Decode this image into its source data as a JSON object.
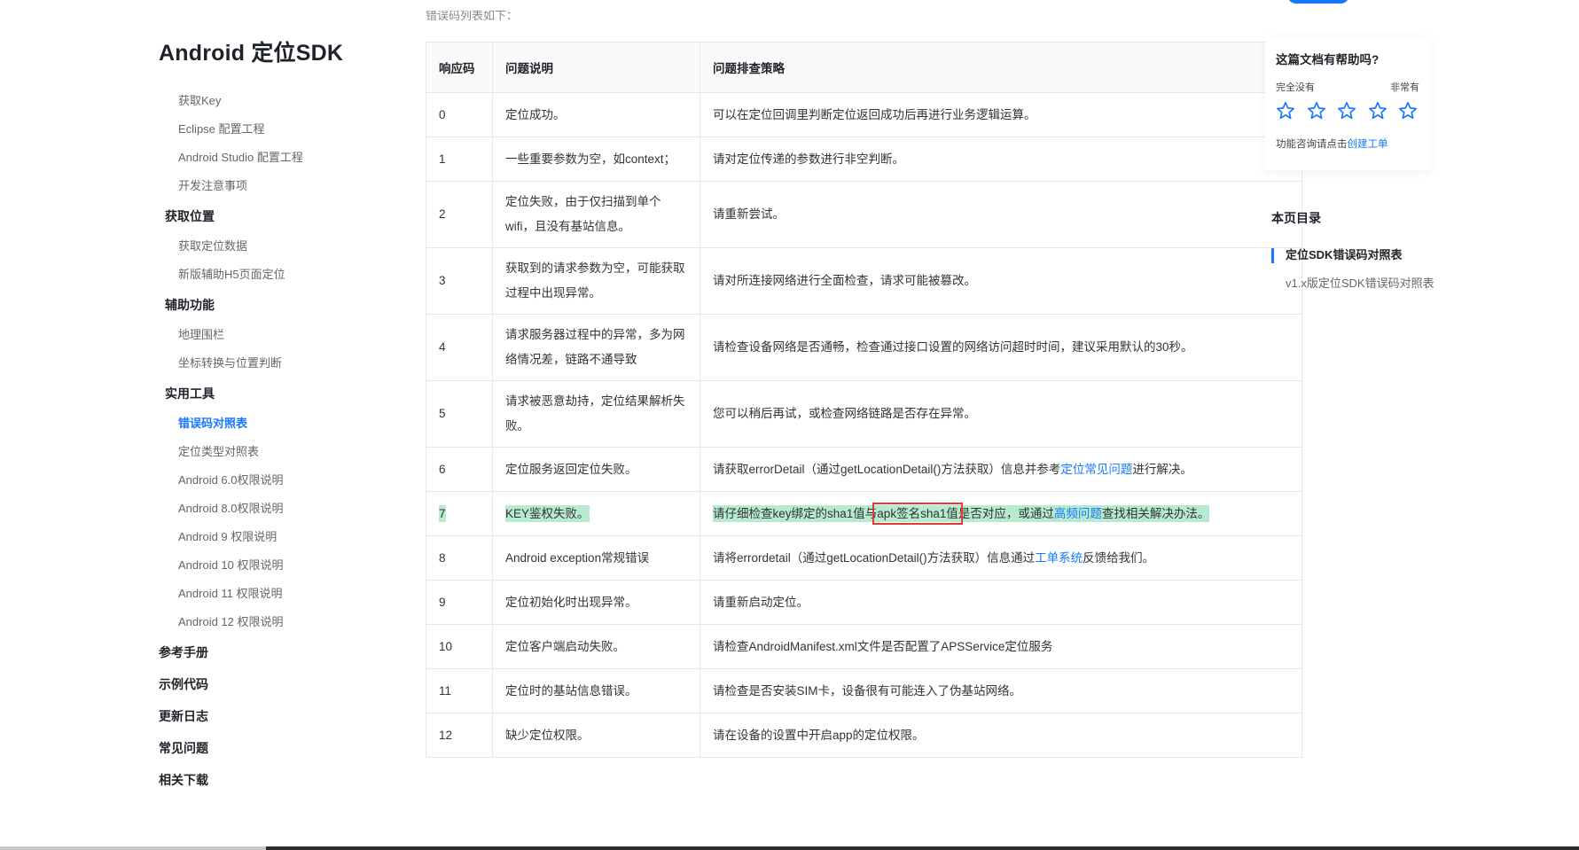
{
  "sidebar": {
    "title": "Android 定位SDK",
    "items": [
      {
        "label": "获取Key",
        "type": "item"
      },
      {
        "label": "Eclipse 配置工程",
        "type": "item"
      },
      {
        "label": "Android Studio 配置工程",
        "type": "item"
      },
      {
        "label": "开发注意事项",
        "type": "item"
      },
      {
        "label": "获取位置",
        "type": "group"
      },
      {
        "label": "获取定位数据",
        "type": "item"
      },
      {
        "label": "新版辅助H5页面定位",
        "type": "item"
      },
      {
        "label": "辅助功能",
        "type": "group"
      },
      {
        "label": "地理围栏",
        "type": "item"
      },
      {
        "label": "坐标转换与位置判断",
        "type": "item"
      },
      {
        "label": "实用工具",
        "type": "group"
      },
      {
        "label": "错误码对照表",
        "type": "item",
        "active": true
      },
      {
        "label": "定位类型对照表",
        "type": "item"
      },
      {
        "label": "Android 6.0权限说明",
        "type": "item"
      },
      {
        "label": "Android 8.0权限说明",
        "type": "item"
      },
      {
        "label": "Android 9 权限说明",
        "type": "item"
      },
      {
        "label": "Android 10 权限说明",
        "type": "item"
      },
      {
        "label": "Android 11 权限说明",
        "type": "item"
      },
      {
        "label": "Android 12 权限说明",
        "type": "item"
      },
      {
        "label": "参考手册",
        "type": "top"
      },
      {
        "label": "示例代码",
        "type": "top"
      },
      {
        "label": "更新日志",
        "type": "top"
      },
      {
        "label": "常见问题",
        "type": "top"
      },
      {
        "label": "相关下载",
        "type": "top"
      }
    ]
  },
  "intro_text": "错误码列表如下：",
  "table": {
    "headers": [
      "响应码",
      "问题说明",
      "问题排查策略"
    ],
    "rows": [
      {
        "code": "0",
        "desc": "定位成功。",
        "strategy": [
          {
            "t": "可以在定位回调里判断定位返回成功后再进行业务逻辑运算。"
          }
        ]
      },
      {
        "code": "1",
        "desc": "一些重要参数为空，如context；",
        "strategy": [
          {
            "t": "请对定位传递的参数进行非空判断。"
          }
        ]
      },
      {
        "code": "2",
        "desc": "定位失败，由于仅扫描到单个wifi，且没有基站信息。",
        "strategy": [
          {
            "t": "请重新尝试。"
          }
        ]
      },
      {
        "code": "3",
        "desc": "获取到的请求参数为空，可能获取过程中出现异常。",
        "strategy": [
          {
            "t": "请对所连接网络进行全面检查，请求可能被篡改。"
          }
        ]
      },
      {
        "code": "4",
        "desc": "请求服务器过程中的异常，多为网络情况差，链路不通导致",
        "strategy": [
          {
            "t": "请检查设备网络是否通畅，检查通过接口设置的网络访问超时时间，建议采用默认的30秒。"
          }
        ]
      },
      {
        "code": "5",
        "desc": "请求被恶意劫持，定位结果解析失败。",
        "strategy": [
          {
            "t": "您可以稍后再试，或检查网络链路是否存在异常。"
          }
        ]
      },
      {
        "code": "6",
        "desc": "定位服务返回定位失败。",
        "strategy": [
          {
            "t": "请获取errorDetail（通过getLocationDetail()方法获取）信息并参考"
          },
          {
            "t": "定位常见问题",
            "link": true
          },
          {
            "t": "进行解决。"
          }
        ]
      },
      {
        "code": "7",
        "desc": "KEY鉴权失败。",
        "highlight": true,
        "strategy": [
          {
            "t": "请仔细检查key绑定的sha1值与"
          },
          {
            "t": "apk签名sha1值",
            "boxed": true
          },
          {
            "t": "是否对应，或通过"
          },
          {
            "t": "高频问题",
            "link": true
          },
          {
            "t": "查找相关解决办法。"
          }
        ]
      },
      {
        "code": "8",
        "desc": "Android exception常规错误",
        "strategy": [
          {
            "t": "请将errordetail（通过getLocationDetail()方法获取）信息通过"
          },
          {
            "t": "工单系统",
            "link": true
          },
          {
            "t": "反馈给我们。"
          }
        ]
      },
      {
        "code": "9",
        "desc": "定位初始化时出现异常。",
        "strategy": [
          {
            "t": "请重新启动定位。"
          }
        ]
      },
      {
        "code": "10",
        "desc": "定位客户端启动失败。",
        "strategy": [
          {
            "t": "请检查AndroidManifest.xml文件是否配置了APSService定位服务"
          }
        ]
      },
      {
        "code": "11",
        "desc": "定位时的基站信息错误。",
        "strategy": [
          {
            "t": "请检查是否安装SIM卡，设备很有可能连入了伪基站网络。"
          }
        ]
      },
      {
        "code": "12",
        "desc": "缺少定位权限。",
        "strategy": [
          {
            "t": "请在设备的设置中开启app的定位权限。"
          }
        ]
      }
    ]
  },
  "feedback": {
    "question": "这篇文档有帮助吗?",
    "low_label": "完全没有",
    "high_label": "非常有",
    "star_count": 5,
    "contact_prefix": "功能咨询请点击",
    "contact_link": "创建工单"
  },
  "toc": {
    "title": "本页目录",
    "items": [
      {
        "label": "定位SDK错误码对照表",
        "active": true
      },
      {
        "label": "v1.x版定位SDK错误码对照表",
        "active": false
      }
    ]
  },
  "colors": {
    "accent": "#1677ff",
    "highlight": "#b7ebcf",
    "annotation_box": "#e53935"
  }
}
